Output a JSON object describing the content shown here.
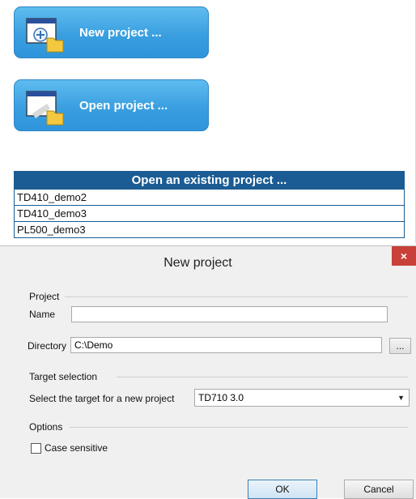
{
  "start_page": {
    "new_project_label": "New project ...",
    "open_project_label": "Open project ...",
    "recent_header": "Open an existing project ...",
    "recent_projects": [
      "TD410_demo2",
      "TD410_demo3",
      "PL500_demo3"
    ]
  },
  "dialog": {
    "title": "New project",
    "close_label": "×",
    "project_group_label": "Project",
    "name_label": "Name",
    "name_value": "",
    "directory_label": "Directory",
    "directory_value": "C:\\Demo",
    "browse_label": "...",
    "target_group_label": "Target selection",
    "target_prompt": "Select the target for a new project",
    "target_value": "TD710 3.0",
    "options_group_label": "Options",
    "case_sensitive_label": "Case sensitive",
    "case_sensitive_checked": false,
    "ok_label": "OK",
    "cancel_label": "Cancel"
  },
  "colors": {
    "accent_blue": "#3a9fe0",
    "table_header": "#1a5c93",
    "close_red": "#c9403a"
  }
}
